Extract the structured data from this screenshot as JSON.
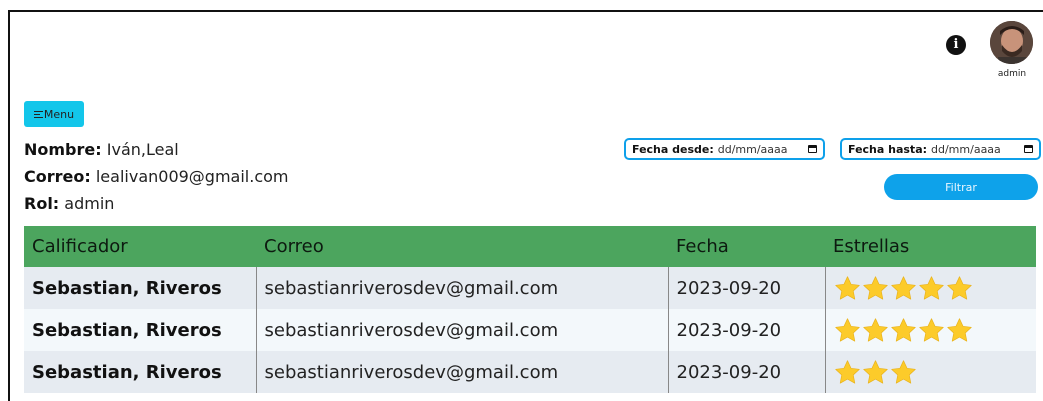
{
  "header": {
    "avatar_label": "admin",
    "info_icon": "info-icon",
    "avatar_icon": "user-avatar"
  },
  "menu": {
    "label": "Menu",
    "icon": "hamburger-icon"
  },
  "profile": {
    "name_label": "Nombre:",
    "name_value": "Iván,Leal",
    "email_label": "Correo:",
    "email_value": "lealivan009@gmail.com",
    "role_label": "Rol:",
    "role_value": "admin"
  },
  "filters": {
    "from_label": "Fecha desde:",
    "from_value": "dd/mm/aaaa",
    "to_label": "Fecha hasta:",
    "to_value": "dd/mm/aaaa",
    "filter_button": "Filtrar"
  },
  "table": {
    "columns": [
      "Calificador",
      "Correo",
      "Fecha",
      "Estrellas"
    ],
    "rows": [
      {
        "name": "Sebastian, Riveros",
        "email": "sebastianriverosdev@gmail.com",
        "date": "2023-09-20",
        "stars": 5
      },
      {
        "name": "Sebastian, Riveros",
        "email": "sebastianriverosdev@gmail.com",
        "date": "2023-09-20",
        "stars": 5
      },
      {
        "name": "Sebastian, Riveros",
        "email": "sebastianriverosdev@gmail.com",
        "date": "2023-09-20",
        "stars": 3
      }
    ],
    "star_color": "#fccb2a"
  },
  "colors": {
    "header_green": "#4ca55e",
    "menu_cyan": "#13c6ea",
    "accent_blue": "#0ea2ea"
  }
}
